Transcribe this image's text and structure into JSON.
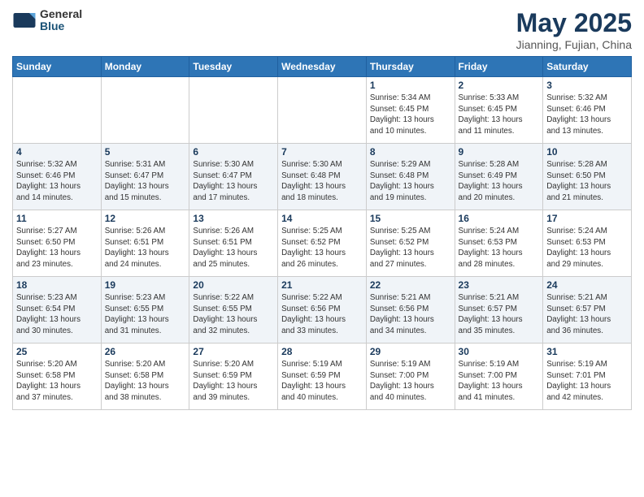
{
  "logo": {
    "general": "General",
    "blue": "Blue"
  },
  "header": {
    "title": "May 2025",
    "location": "Jianning, Fujian, China"
  },
  "weekdays": [
    "Sunday",
    "Monday",
    "Tuesday",
    "Wednesday",
    "Thursday",
    "Friday",
    "Saturday"
  ],
  "weeks": [
    [
      {
        "day": "",
        "info": ""
      },
      {
        "day": "",
        "info": ""
      },
      {
        "day": "",
        "info": ""
      },
      {
        "day": "",
        "info": ""
      },
      {
        "day": "1",
        "info": "Sunrise: 5:34 AM\nSunset: 6:45 PM\nDaylight: 13 hours\nand 10 minutes."
      },
      {
        "day": "2",
        "info": "Sunrise: 5:33 AM\nSunset: 6:45 PM\nDaylight: 13 hours\nand 11 minutes."
      },
      {
        "day": "3",
        "info": "Sunrise: 5:32 AM\nSunset: 6:46 PM\nDaylight: 13 hours\nand 13 minutes."
      }
    ],
    [
      {
        "day": "4",
        "info": "Sunrise: 5:32 AM\nSunset: 6:46 PM\nDaylight: 13 hours\nand 14 minutes."
      },
      {
        "day": "5",
        "info": "Sunrise: 5:31 AM\nSunset: 6:47 PM\nDaylight: 13 hours\nand 15 minutes."
      },
      {
        "day": "6",
        "info": "Sunrise: 5:30 AM\nSunset: 6:47 PM\nDaylight: 13 hours\nand 17 minutes."
      },
      {
        "day": "7",
        "info": "Sunrise: 5:30 AM\nSunset: 6:48 PM\nDaylight: 13 hours\nand 18 minutes."
      },
      {
        "day": "8",
        "info": "Sunrise: 5:29 AM\nSunset: 6:48 PM\nDaylight: 13 hours\nand 19 minutes."
      },
      {
        "day": "9",
        "info": "Sunrise: 5:28 AM\nSunset: 6:49 PM\nDaylight: 13 hours\nand 20 minutes."
      },
      {
        "day": "10",
        "info": "Sunrise: 5:28 AM\nSunset: 6:50 PM\nDaylight: 13 hours\nand 21 minutes."
      }
    ],
    [
      {
        "day": "11",
        "info": "Sunrise: 5:27 AM\nSunset: 6:50 PM\nDaylight: 13 hours\nand 23 minutes."
      },
      {
        "day": "12",
        "info": "Sunrise: 5:26 AM\nSunset: 6:51 PM\nDaylight: 13 hours\nand 24 minutes."
      },
      {
        "day": "13",
        "info": "Sunrise: 5:26 AM\nSunset: 6:51 PM\nDaylight: 13 hours\nand 25 minutes."
      },
      {
        "day": "14",
        "info": "Sunrise: 5:25 AM\nSunset: 6:52 PM\nDaylight: 13 hours\nand 26 minutes."
      },
      {
        "day": "15",
        "info": "Sunrise: 5:25 AM\nSunset: 6:52 PM\nDaylight: 13 hours\nand 27 minutes."
      },
      {
        "day": "16",
        "info": "Sunrise: 5:24 AM\nSunset: 6:53 PM\nDaylight: 13 hours\nand 28 minutes."
      },
      {
        "day": "17",
        "info": "Sunrise: 5:24 AM\nSunset: 6:53 PM\nDaylight: 13 hours\nand 29 minutes."
      }
    ],
    [
      {
        "day": "18",
        "info": "Sunrise: 5:23 AM\nSunset: 6:54 PM\nDaylight: 13 hours\nand 30 minutes."
      },
      {
        "day": "19",
        "info": "Sunrise: 5:23 AM\nSunset: 6:55 PM\nDaylight: 13 hours\nand 31 minutes."
      },
      {
        "day": "20",
        "info": "Sunrise: 5:22 AM\nSunset: 6:55 PM\nDaylight: 13 hours\nand 32 minutes."
      },
      {
        "day": "21",
        "info": "Sunrise: 5:22 AM\nSunset: 6:56 PM\nDaylight: 13 hours\nand 33 minutes."
      },
      {
        "day": "22",
        "info": "Sunrise: 5:21 AM\nSunset: 6:56 PM\nDaylight: 13 hours\nand 34 minutes."
      },
      {
        "day": "23",
        "info": "Sunrise: 5:21 AM\nSunset: 6:57 PM\nDaylight: 13 hours\nand 35 minutes."
      },
      {
        "day": "24",
        "info": "Sunrise: 5:21 AM\nSunset: 6:57 PM\nDaylight: 13 hours\nand 36 minutes."
      }
    ],
    [
      {
        "day": "25",
        "info": "Sunrise: 5:20 AM\nSunset: 6:58 PM\nDaylight: 13 hours\nand 37 minutes."
      },
      {
        "day": "26",
        "info": "Sunrise: 5:20 AM\nSunset: 6:58 PM\nDaylight: 13 hours\nand 38 minutes."
      },
      {
        "day": "27",
        "info": "Sunrise: 5:20 AM\nSunset: 6:59 PM\nDaylight: 13 hours\nand 39 minutes."
      },
      {
        "day": "28",
        "info": "Sunrise: 5:19 AM\nSunset: 6:59 PM\nDaylight: 13 hours\nand 40 minutes."
      },
      {
        "day": "29",
        "info": "Sunrise: 5:19 AM\nSunset: 7:00 PM\nDaylight: 13 hours\nand 40 minutes."
      },
      {
        "day": "30",
        "info": "Sunrise: 5:19 AM\nSunset: 7:00 PM\nDaylight: 13 hours\nand 41 minutes."
      },
      {
        "day": "31",
        "info": "Sunrise: 5:19 AM\nSunset: 7:01 PM\nDaylight: 13 hours\nand 42 minutes."
      }
    ]
  ]
}
